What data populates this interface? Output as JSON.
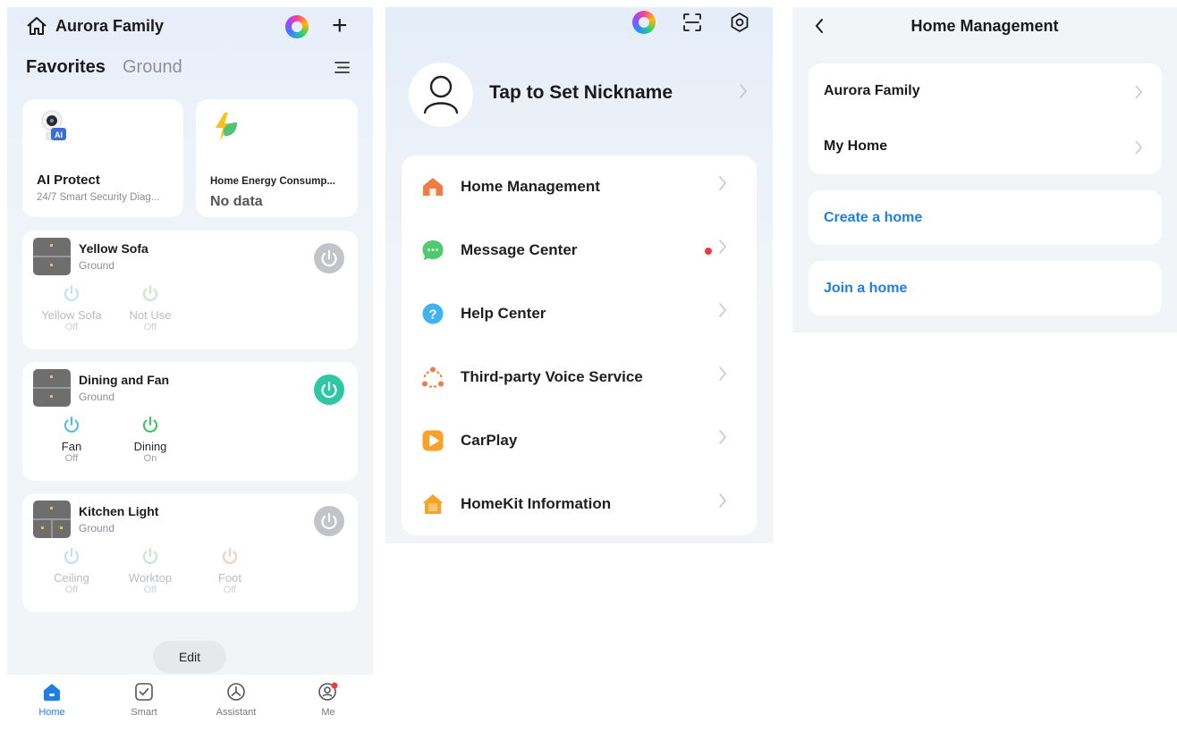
{
  "home": {
    "family_name": "Aurora Family",
    "tabs": [
      "Favorites",
      "Ground"
    ],
    "cards": [
      {
        "title": "AI Protect",
        "subtitle": "24/7 Smart Security Diag..."
      },
      {
        "title": "Home Energy Consump...",
        "subtitle": "No data"
      }
    ],
    "devices": [
      {
        "name": "Yellow Sofa",
        "room": "Ground",
        "power": "off",
        "switches": [
          {
            "name": "Yellow Sofa",
            "state": "Off"
          },
          {
            "name": "Not Use",
            "state": "Off"
          }
        ]
      },
      {
        "name": "Dining and Fan",
        "room": "Ground",
        "power": "on",
        "switches": [
          {
            "name": "Fan",
            "state": "Off"
          },
          {
            "name": "Dining",
            "state": "On"
          }
        ]
      },
      {
        "name": "Kitchen Light",
        "room": "Ground",
        "power": "off",
        "switches": [
          {
            "name": "Ceiling",
            "state": "Off"
          },
          {
            "name": "Worktop",
            "state": "Off"
          },
          {
            "name": "Foot",
            "state": "Off"
          }
        ]
      }
    ],
    "edit_label": "Edit",
    "nav": [
      {
        "label": "Home",
        "icon": "home-icon",
        "active": true
      },
      {
        "label": "Smart",
        "icon": "checkbox-icon",
        "active": false
      },
      {
        "label": "Assistant",
        "icon": "assistant-icon",
        "active": false
      },
      {
        "label": "Me",
        "icon": "user-icon",
        "active": false
      }
    ]
  },
  "me": {
    "nickname_prompt": "Tap to Set Nickname",
    "menu": [
      {
        "label": "Home Management",
        "icon": "house-icon",
        "color": "#f07b45"
      },
      {
        "label": "Message Center",
        "icon": "message-icon",
        "color": "#4fca6e",
        "badge": true
      },
      {
        "label": "Help Center",
        "icon": "help-icon",
        "color": "#3fb3f0"
      },
      {
        "label": "Third-party Voice Service",
        "icon": "voice-service-icon",
        "color": "#f07b45"
      },
      {
        "label": "CarPlay",
        "icon": "carplay-icon",
        "color": "#f9a12b"
      },
      {
        "label": "HomeKit Information",
        "icon": "homekit-icon",
        "color": "#f9a12b"
      }
    ]
  },
  "home_management": {
    "title": "Home Management",
    "homes": [
      "Aurora Family",
      "My Home"
    ],
    "create_label": "Create a home",
    "join_label": "Join a home"
  },
  "colors": {
    "accent_blue": "#1f7ee6",
    "power_on": "#2ec7a3",
    "power_off": "#c2c4c8",
    "badge_red": "#ee3b3b"
  }
}
